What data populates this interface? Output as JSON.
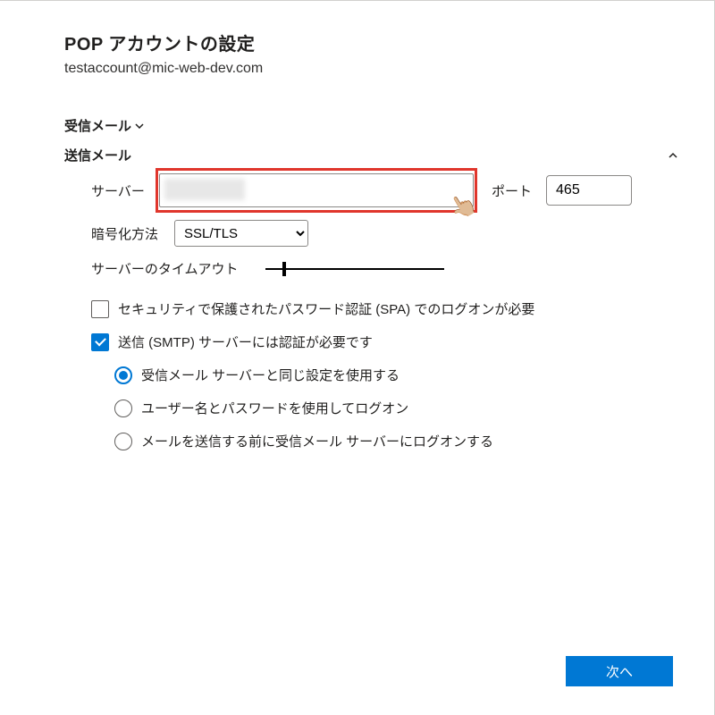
{
  "header": {
    "title": "POP アカウントの設定",
    "account_email": "testaccount@mic-web-dev.com"
  },
  "sections": {
    "incoming_label": "受信メール",
    "outgoing_label": "送信メール"
  },
  "outgoing": {
    "server_label": "サーバー",
    "server_value": "",
    "port_label": "ポート",
    "port_value": "465",
    "encryption_label": "暗号化方法",
    "encryption_value": "SSL/TLS",
    "timeout_label": "サーバーのタイムアウト",
    "timeout_value": 10,
    "spa_label": "セキュリティで保護されたパスワード認証 (SPA) でのログオンが必要",
    "spa_checked": false,
    "smtp_auth_label": "送信 (SMTP) サーバーには認証が必要です",
    "smtp_auth_checked": true,
    "auth_options": [
      {
        "label": "受信メール サーバーと同じ設定を使用する",
        "selected": true
      },
      {
        "label": "ユーザー名とパスワードを使用してログオン",
        "selected": false
      },
      {
        "label": "メールを送信する前に受信メール サーバーにログオンする",
        "selected": false
      }
    ]
  },
  "footer": {
    "next_label": "次へ"
  }
}
